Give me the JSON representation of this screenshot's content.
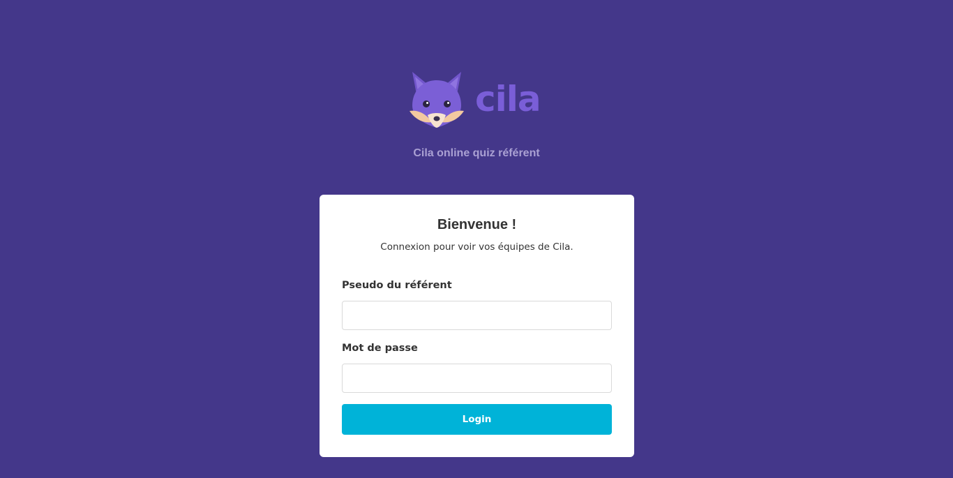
{
  "brand": {
    "name": "cila",
    "logo_icon": "fox-icon",
    "tagline": "Cila online quiz référent"
  },
  "login_card": {
    "title": "Bienvenue !",
    "subtitle": "Connexion pour voir vos équipes de Cila.",
    "username_label": "Pseudo du référent",
    "username_value": "",
    "password_label": "Mot de passe",
    "password_value": "",
    "submit_label": "Login"
  },
  "colors": {
    "background": "#44378a",
    "brand": "#7a5ed8",
    "button": "#00b3d8"
  }
}
